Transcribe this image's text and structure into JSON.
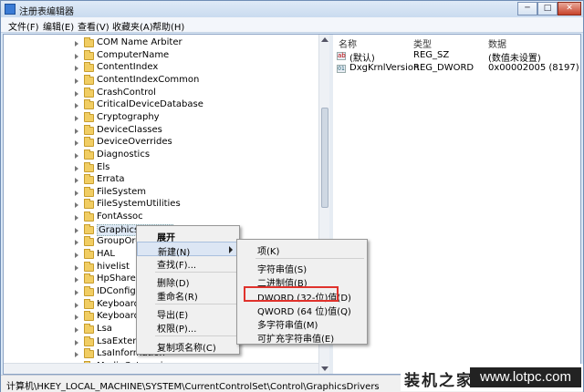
{
  "window": {
    "title": "注册表编辑器",
    "minimize": "─",
    "maximize": "□",
    "close": "✕"
  },
  "menubar": [
    "文件(F)",
    "编辑(E)",
    "查看(V)",
    "收藏夹(A)",
    "帮助(H)"
  ],
  "tree": {
    "items": [
      {
        "label": "COM Name Arbiter"
      },
      {
        "label": "ComputerName"
      },
      {
        "label": "ContentIndex"
      },
      {
        "label": "ContentIndexCommon"
      },
      {
        "label": "CrashControl"
      },
      {
        "label": "CriticalDeviceDatabase"
      },
      {
        "label": "Cryptography"
      },
      {
        "label": "DeviceClasses"
      },
      {
        "label": "DeviceOverrides"
      },
      {
        "label": "Diagnostics"
      },
      {
        "label": "Els"
      },
      {
        "label": "Errata"
      },
      {
        "label": "FileSystem"
      },
      {
        "label": "FileSystemUtilities"
      },
      {
        "label": "FontAssoc"
      },
      {
        "label": "GraphicsDrivers",
        "selected": true
      },
      {
        "label": "GroupOrderList"
      },
      {
        "label": "HAL"
      },
      {
        "label": "hivelist"
      },
      {
        "label": "HpShared"
      },
      {
        "label": "IDConfigDB"
      },
      {
        "label": "Keyboard Layout"
      },
      {
        "label": "Keyboard Layouts"
      },
      {
        "label": "Lsa"
      },
      {
        "label": "LsaExtensionConfig"
      },
      {
        "label": "LsaInformation"
      },
      {
        "label": "MediaCategories"
      }
    ]
  },
  "list": {
    "headers": {
      "name": "名称",
      "type": "类型",
      "data": "数据"
    },
    "rows": [
      {
        "icon": "ab",
        "name": "(默认)",
        "type": "REG_SZ",
        "data": "(数值未设置)"
      },
      {
        "icon": "binary",
        "name": "DxgKrnlVersion",
        "type": "REG_DWORD",
        "data": "0x00002005 (8197)"
      }
    ]
  },
  "context_menu": {
    "items": [
      "展开",
      "新建(N)",
      "查找(F)...",
      "删除(D)",
      "重命名(R)",
      "导出(E)",
      "权限(P)...",
      "复制项名称(C)"
    ]
  },
  "submenu": {
    "items": [
      "项(K)",
      "字符串值(S)",
      "二进制值(B)",
      "DWORD (32-位)值(D)",
      "QWORD (64 位)值(Q)",
      "多字符串值(M)",
      "可扩充字符串值(E)"
    ],
    "highlighted": "DWORD (32-位)值(D)"
  },
  "statusbar": {
    "path": "计算机\\HKEY_LOCAL_MACHINE\\SYSTEM\\CurrentControlSet\\Control\\GraphicsDrivers"
  },
  "watermark": {
    "text": "装机之家",
    "url": "www.lotpc.com"
  }
}
